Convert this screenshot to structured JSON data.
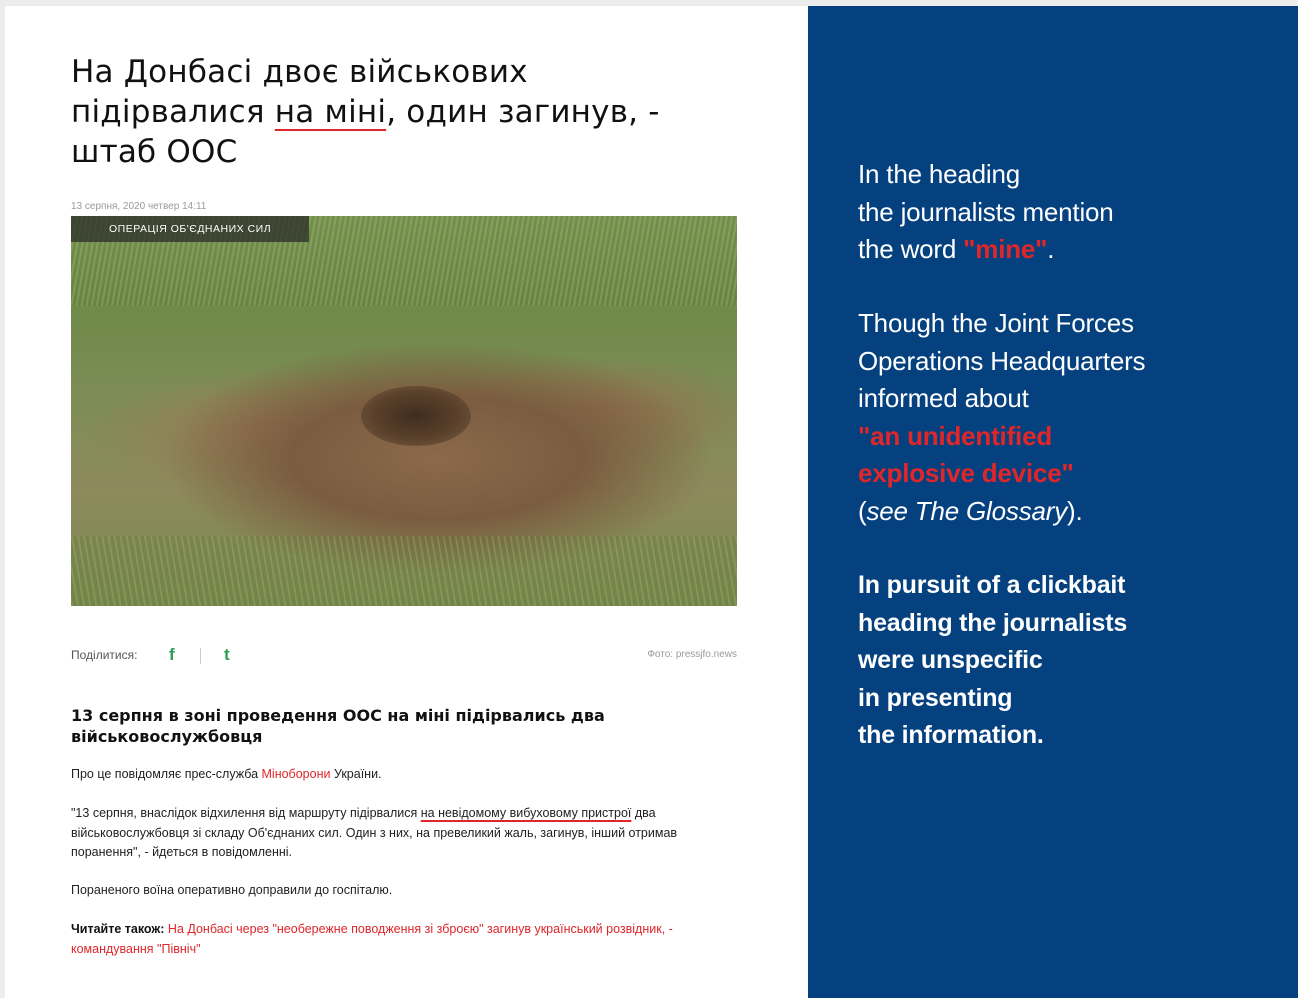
{
  "article": {
    "headline_before": "На Донбасі двоє військових підірвалися ",
    "headline_highlight": "на міні",
    "headline_after": ", один загинув, - штаб ООС",
    "date": "13 серпня, 2020 четвер  14:11",
    "category_badge": "ОПЕРАЦІЯ ОБ'ЄДНАНИХ СИЛ",
    "share_label": "Поділитися:",
    "share_facebook_icon": "f",
    "share_twitter_icon": "t",
    "photo_credit": "Фото: pressjfo.news",
    "lead": "13 серпня в зоні проведення ООС на міні підірвались два військовослужбовця",
    "p1_before": "Про це повідомляє прес-служба ",
    "p1_link": "Міноборони",
    "p1_after": " України.",
    "p2_before": "\"13 серпня, внаслідок відхилення від маршруту підірвалися ",
    "p2_highlight": "на невідомому вибуховому пристрої",
    "p2_after": " два військовослужбовця зі складу Об'єднаних сил. Один з них, на превеликий жаль, загинув, інший отримав поранення\", - йдеться в повідомленні.",
    "p3": "Пораненого воїна оперативно доправили до госпіталю.",
    "read_also_label": "Читайте також:",
    "read_also_link": "На Донбасі через \"необережне поводження зі зброєю\" загинув український розвідник, - командування \"Північ\""
  },
  "sidebar": {
    "block1_line1": "In the heading",
    "block1_line2": "the journalists mention",
    "block1_line3_before": "the word ",
    "block1_highlight": "\"mine\"",
    "block1_line3_after": ".",
    "block2_line1": "Though the Joint Forces",
    "block2_line2": "Operations Headquarters",
    "block2_line3": "informed about",
    "block2_highlight_line1": "\"an unidentified",
    "block2_highlight_line2": "explosive device\"",
    "block2_paren_open": "(",
    "block2_glossary": "see The Glossary",
    "block2_paren_close": ").",
    "block3_line1": "In pursuit of a clickbait",
    "block3_line2": "heading the journalists",
    "block3_line3": "were unspecific",
    "block3_line4": "in presenting",
    "block3_line5": "the information."
  },
  "colors": {
    "accent_red": "#e0262a",
    "sidebar_blue": "#06417f",
    "share_green": "#2a9d55"
  }
}
